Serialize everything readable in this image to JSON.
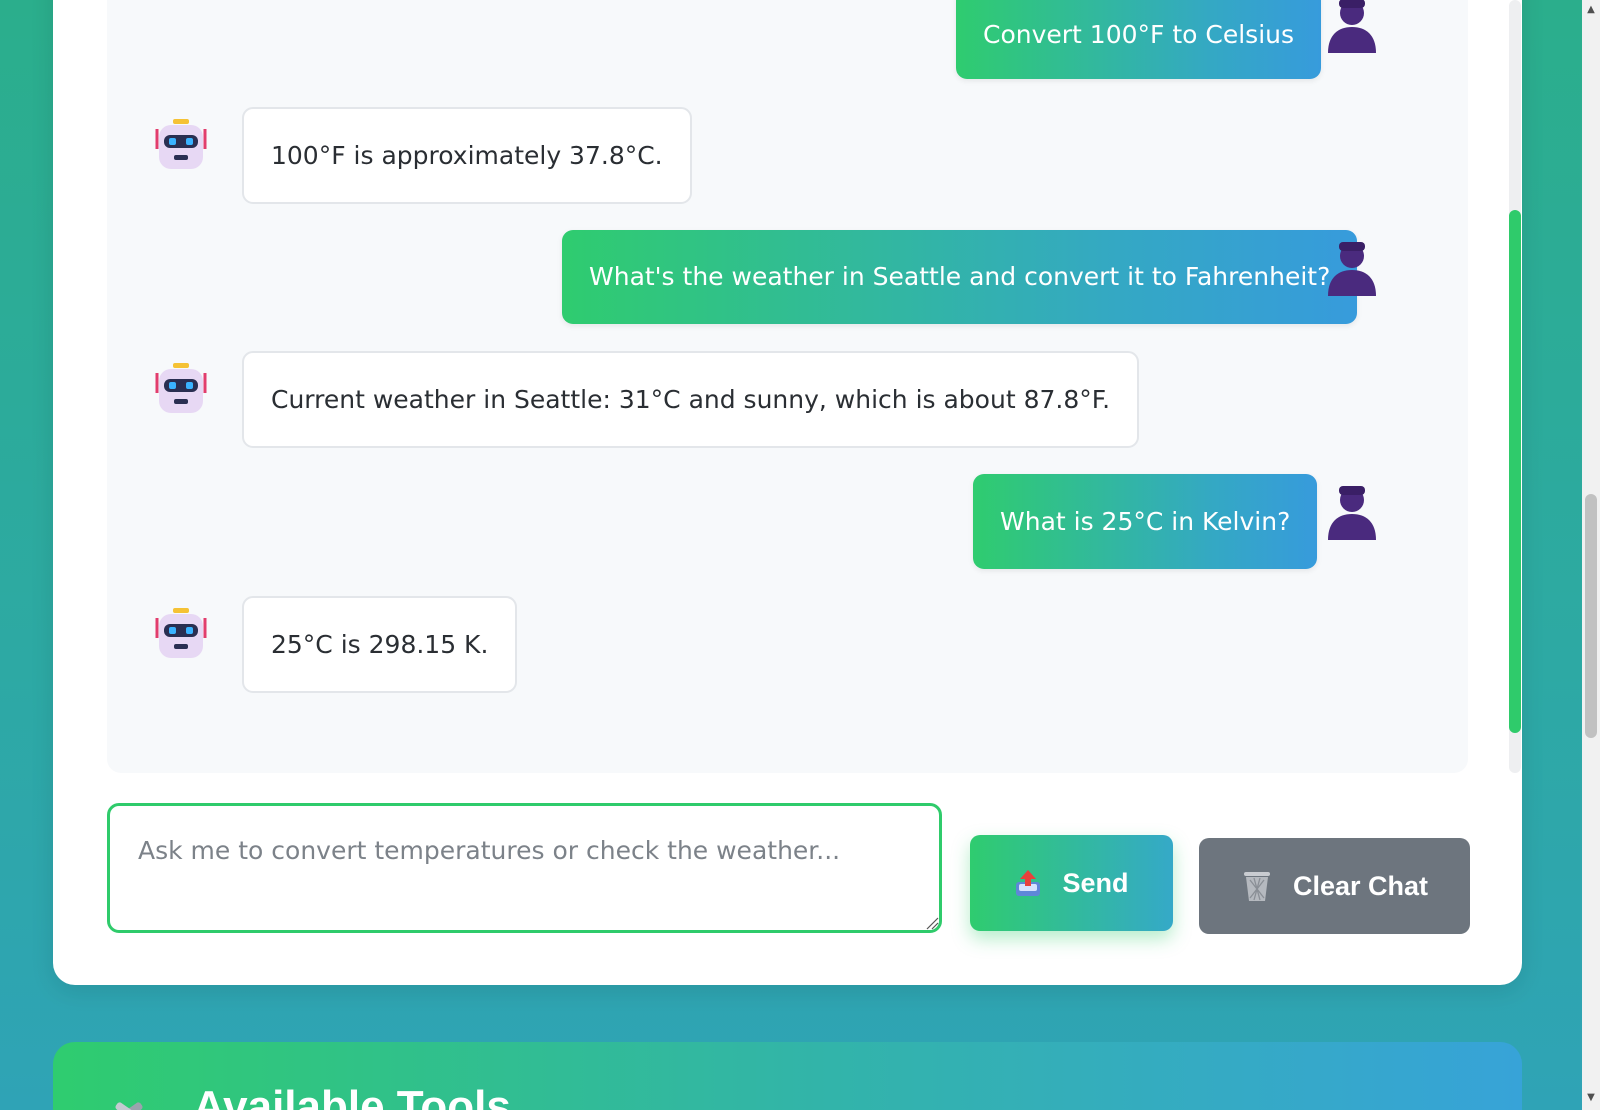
{
  "chat": {
    "messages": [
      {
        "role": "user",
        "text": "Convert 100°F to Celsius"
      },
      {
        "role": "bot",
        "text": "100°F is approximately 37.8°C."
      },
      {
        "role": "user",
        "text": "What's the weather in Seattle and convert it to Fahrenheit?"
      },
      {
        "role": "bot",
        "text": "Current weather in Seattle: 31°C and sunny, which is about 87.8°F."
      },
      {
        "role": "user",
        "text": "What is 25°C in Kelvin?"
      },
      {
        "role": "bot",
        "text": "25°C is 298.15 K."
      }
    ],
    "avatars": {
      "user": "user-silhouette-icon",
      "bot": "robot-icon"
    }
  },
  "composer": {
    "placeholder": "Ask me to convert temperatures or check the weather...",
    "value": ""
  },
  "buttons": {
    "send_label": "Send",
    "send_icon": "outbox-tray-icon",
    "clear_label": "Clear Chat",
    "clear_icon": "wastebasket-icon"
  },
  "tools": {
    "title": "Available Tools",
    "icon": "tools-icon"
  },
  "colors": {
    "accent_green": "#2fcb6b",
    "accent_blue": "#379bdc",
    "clear_button": "#6d757e",
    "user_avatar": "#4a2a7e"
  }
}
